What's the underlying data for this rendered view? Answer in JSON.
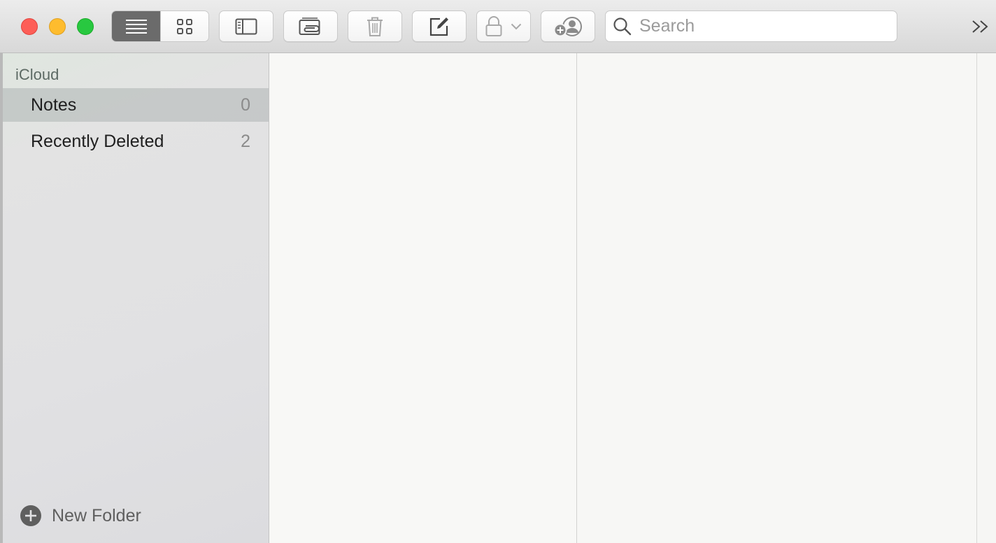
{
  "toolbar": {
    "search": {
      "placeholder": "Search"
    }
  },
  "sidebar": {
    "group_title": "iCloud",
    "folders": [
      {
        "name": "Notes",
        "count": "0",
        "selected": true
      },
      {
        "name": "Recently Deleted",
        "count": "2",
        "selected": false
      }
    ],
    "new_folder_label": "New Folder"
  },
  "icons": {
    "list_view": "list-icon",
    "gallery_view": "grid-icon",
    "sidebar_toggle": "sidebar-icon",
    "attachments": "attachment-icon",
    "delete": "trash-icon",
    "compose": "compose-icon",
    "lock": "lock-icon",
    "share": "add-person-icon",
    "search": "search-icon",
    "overflow": "chevron-double-right-icon",
    "new_folder": "plus-circle-icon"
  },
  "colors": {
    "close": "#fd5e57",
    "minimize": "#febc2e",
    "maximize": "#28c840",
    "selection": "#c5cac8",
    "active_segment": "#6b6b6b"
  }
}
